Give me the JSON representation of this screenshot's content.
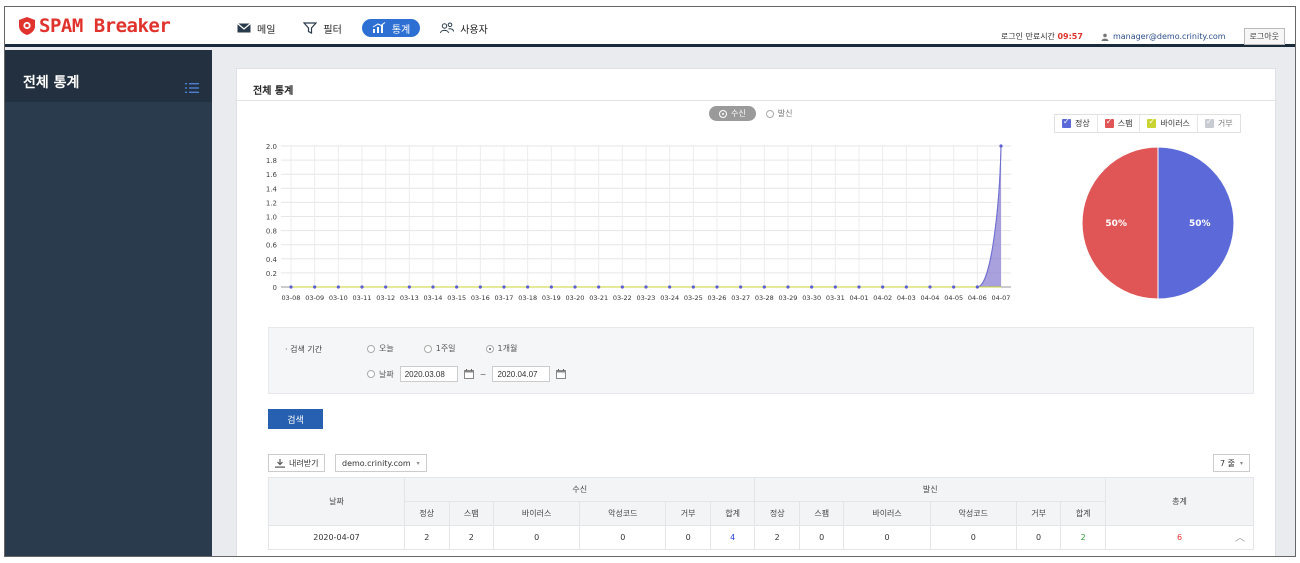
{
  "app": {
    "logo_text": "SPAM Breaker"
  },
  "nav": [
    {
      "label": "메일",
      "icon": "mail-icon"
    },
    {
      "label": "필터",
      "icon": "filter-icon"
    },
    {
      "label": "통계",
      "icon": "chart-icon",
      "active": true
    },
    {
      "label": "사용자",
      "icon": "users-icon"
    }
  ],
  "topright": {
    "timer_label": "로그인 만료시간",
    "timer_value": "09:57",
    "user_email": "manager@demo.crinity.com",
    "logout_label": "로그아웃"
  },
  "sidebar": {
    "title": "전체 통계"
  },
  "panel": {
    "title": "전체 통계",
    "mode_on": "수신",
    "mode_off": "발신"
  },
  "legend": [
    {
      "label": "정상",
      "color": "#5b6ad8"
    },
    {
      "label": "스팸",
      "color": "#e05656"
    },
    {
      "label": "바이러스",
      "color": "#c9d432"
    },
    {
      "label": "거부",
      "color": "#c8cbd2"
    }
  ],
  "chart_data": [
    {
      "type": "area",
      "categories": [
        "03-08",
        "03-09",
        "03-10",
        "03-11",
        "03-12",
        "03-13",
        "03-14",
        "03-15",
        "03-16",
        "03-17",
        "03-18",
        "03-19",
        "03-20",
        "03-21",
        "03-22",
        "03-23",
        "03-24",
        "03-25",
        "03-26",
        "03-27",
        "03-28",
        "03-29",
        "03-30",
        "03-31",
        "04-01",
        "04-02",
        "04-03",
        "04-04",
        "04-05",
        "04-06",
        "04-07"
      ],
      "series": [
        {
          "name": "정상",
          "values": [
            0,
            0,
            0,
            0,
            0,
            0,
            0,
            0,
            0,
            0,
            0,
            0,
            0,
            0,
            0,
            0,
            0,
            0,
            0,
            0,
            0,
            0,
            0,
            0,
            0,
            0,
            0,
            0,
            0,
            0,
            2
          ],
          "color": "#6b6fd0"
        },
        {
          "name": "스팸",
          "values": [
            0,
            0,
            0,
            0,
            0,
            0,
            0,
            0,
            0,
            0,
            0,
            0,
            0,
            0,
            0,
            0,
            0,
            0,
            0,
            0,
            0,
            0,
            0,
            0,
            0,
            0,
            0,
            0,
            0,
            0,
            2
          ],
          "color": "#b48ad0"
        },
        {
          "name": "바이러스",
          "values": [
            0,
            0,
            0,
            0,
            0,
            0,
            0,
            0,
            0,
            0,
            0,
            0,
            0,
            0,
            0,
            0,
            0,
            0,
            0,
            0,
            0,
            0,
            0,
            0,
            0,
            0,
            0,
            0,
            0,
            0,
            0
          ],
          "color": "#c9d432"
        }
      ],
      "yticks": [
        "2.0",
        "1.8",
        "1.6",
        "1.4",
        "1.2",
        "1.0",
        "0.8",
        "0.6",
        "0.4",
        "0.2",
        "0"
      ],
      "ylim": [
        0,
        2
      ],
      "grid": true
    },
    {
      "type": "pie",
      "slices": [
        {
          "label": "정상",
          "value": 50,
          "text": "50%",
          "color": "#5b6ad8"
        },
        {
          "label": "스팸",
          "value": 50,
          "text": "50%",
          "color": "#e05656"
        }
      ]
    }
  ],
  "search": {
    "period_label": "· 검색 기간",
    "options": [
      "오늘",
      "1주일",
      "1개월"
    ],
    "selected": "1개월",
    "date_option": "날짜",
    "date_from": "2020.03.08",
    "date_to": "2020.04.07",
    "date_sep": "~",
    "button": "검색"
  },
  "toolbar": {
    "download": "내려받기",
    "domain": "demo.crinity.com",
    "rows": "7 줄"
  },
  "table": {
    "date_header": "날짜",
    "recv_header": "수신",
    "send_header": "발신",
    "total_header": "총계",
    "sub_headers": [
      "정상",
      "스팸",
      "바이러스",
      "악성코드",
      "거부",
      "합계"
    ],
    "rows": [
      {
        "date": "2020-04-07",
        "recv": [
          "2",
          "2",
          "0",
          "0",
          "0",
          "4"
        ],
        "send": [
          "2",
          "0",
          "0",
          "0",
          "0",
          "2"
        ],
        "total": "6"
      }
    ]
  }
}
